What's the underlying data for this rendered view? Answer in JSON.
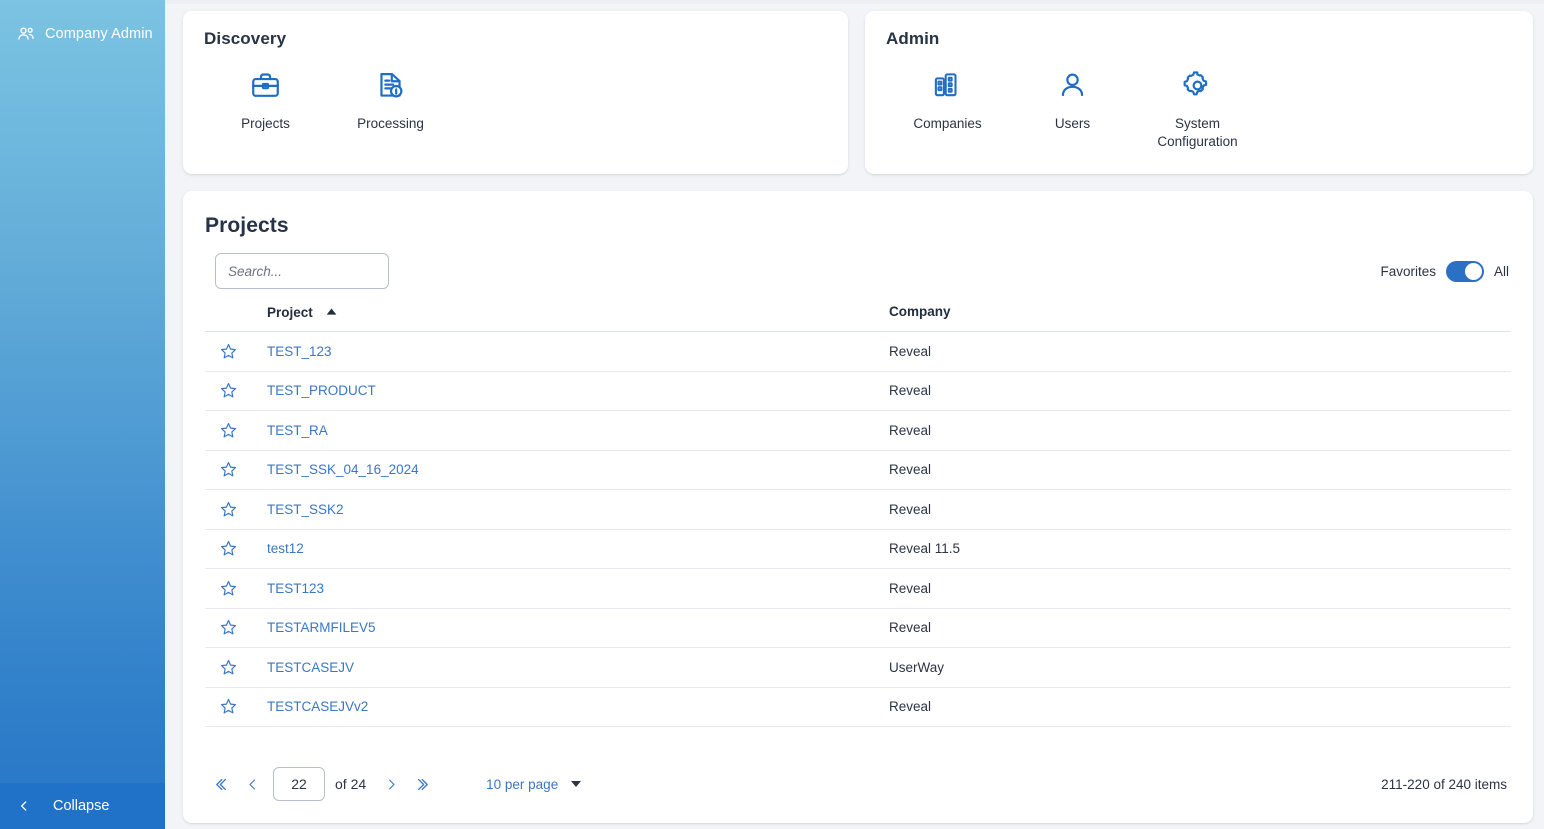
{
  "sidebar": {
    "header_label": "Company Admin",
    "header_icon": "users-group-icon",
    "collapse_label": "Collapse",
    "collapse_icon": "chevron-left-icon"
  },
  "discovery": {
    "title": "Discovery",
    "tiles": [
      {
        "label": "Projects",
        "icon": "briefcase-icon"
      },
      {
        "label": "Processing",
        "icon": "document-info-icon"
      }
    ]
  },
  "admin": {
    "title": "Admin",
    "tiles": [
      {
        "label": "Companies",
        "icon": "buildings-icon"
      },
      {
        "label": "Users",
        "icon": "user-icon"
      },
      {
        "label": "System Configuration",
        "icon": "gear-icon"
      }
    ]
  },
  "projects_panel": {
    "title": "Projects",
    "search": {
      "value": "",
      "placeholder": "Search..."
    },
    "filter_toggle": {
      "left_label": "Favorites",
      "right_label": "All",
      "state": "All"
    },
    "columns": [
      {
        "key": "star",
        "label": ""
      },
      {
        "key": "project",
        "label": "Project",
        "sort": "asc",
        "sort_icon": "caret-up-icon"
      },
      {
        "key": "company",
        "label": "Company"
      }
    ],
    "rows": [
      {
        "star": "star-outline-icon",
        "project": "TEST_123",
        "company": "Reveal"
      },
      {
        "star": "star-outline-icon",
        "project": "TEST_PRODUCT",
        "company": "Reveal"
      },
      {
        "star": "star-outline-icon",
        "project": "TEST_RA",
        "company": "Reveal"
      },
      {
        "star": "star-outline-icon",
        "project": "TEST_SSK_04_16_2024",
        "company": "Reveal"
      },
      {
        "star": "star-outline-icon",
        "project": "TEST_SSK2",
        "company": "Reveal"
      },
      {
        "star": "star-outline-icon",
        "project": "test12",
        "company": "Reveal 11.5"
      },
      {
        "star": "star-outline-icon",
        "project": "TEST123",
        "company": "Reveal"
      },
      {
        "star": "star-outline-icon",
        "project": "TESTARMFILEV5",
        "company": "Reveal"
      },
      {
        "star": "star-outline-icon",
        "project": "TESTCASEJV",
        "company": "UserWay"
      },
      {
        "star": "star-outline-icon",
        "project": "TESTCASEJVv2",
        "company": "Reveal"
      }
    ],
    "pagination": {
      "first_icon": "double-chevron-left-icon",
      "prev_icon": "chevron-left-icon",
      "current_page": "22",
      "of_pages": "of 24",
      "next_icon": "chevron-right-icon",
      "last_icon": "double-chevron-right-icon",
      "per_page_label": "10 per page",
      "per_page_caret": "caret-down-icon",
      "item_count": "211-220 of 240 items"
    }
  },
  "colors": {
    "accent_blue": "#3a77c4",
    "toggle_on": "#2a71c5",
    "sidebar_top": "#7cc3e2",
    "sidebar_bottom": "#2576c6",
    "collapse_bar": "#1f72c8",
    "page_bg": "#f2f4f8",
    "text": "#2b3445"
  }
}
